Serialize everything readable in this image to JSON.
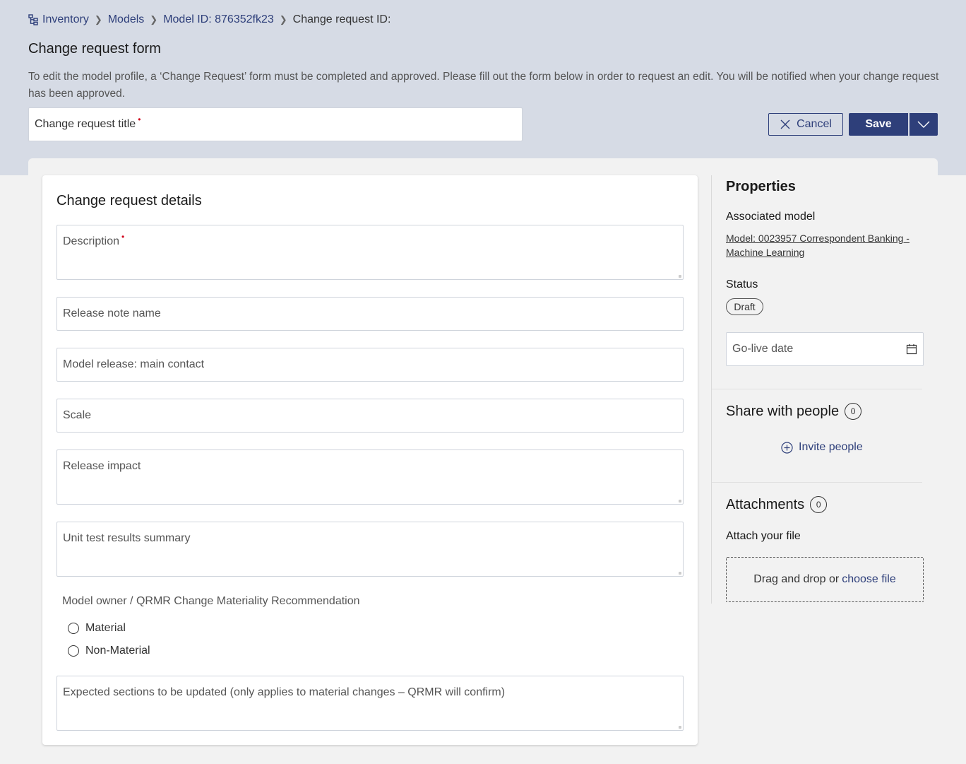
{
  "breadcrumb": {
    "items": [
      "Inventory",
      "Models",
      "Model ID: 876352fk23"
    ],
    "current": "Change request ID:"
  },
  "page": {
    "title": "Change request form",
    "intro": "To edit the model profile, a ‘Change Request’ form must be completed and approved. Please fill out the form below in order to request an edit. You will be notified when your change request has been approved.",
    "title_field_placeholder": "Change request title",
    "required_mark": "*"
  },
  "actions": {
    "cancel_label": "Cancel",
    "save_label": "Save"
  },
  "details": {
    "title": "Change request details",
    "fields": {
      "description": "Description",
      "release_note_name": "Release note name",
      "main_contact": "Model release: main contact",
      "scale": "Scale",
      "release_impact": "Release impact",
      "unit_test_summary": "Unit test results summary",
      "expected_sections": "Expected sections to be updated (only applies to material changes – QRMR will confirm)"
    },
    "materiality": {
      "label": "Model owner / QRMR Change Materiality Recommendation",
      "options": [
        "Material",
        "Non-Material"
      ]
    }
  },
  "properties": {
    "title": "Properties",
    "associated_model_label": "Associated model",
    "associated_model_link": "Model: 0023957 Correspondent Banking - Machine Learning",
    "status_label": "Status",
    "status_value": "Draft",
    "go_live_placeholder": "Go-live date"
  },
  "share": {
    "title": "Share with people",
    "count": "0",
    "invite_label": "Invite people"
  },
  "attachments": {
    "title": "Attachments",
    "count": "0",
    "attach_label": "Attach your file",
    "drop_text": "Drag and drop or",
    "choose_text": "choose file"
  },
  "colors": {
    "header_band": "#d6dbe5",
    "primary": "#2e3f7a",
    "required": "#d0021b"
  },
  "icons": [
    "hierarchy-icon",
    "chevron-right-icon",
    "close-icon",
    "chevron-down-icon",
    "calendar-icon",
    "plus-circle-icon"
  ]
}
